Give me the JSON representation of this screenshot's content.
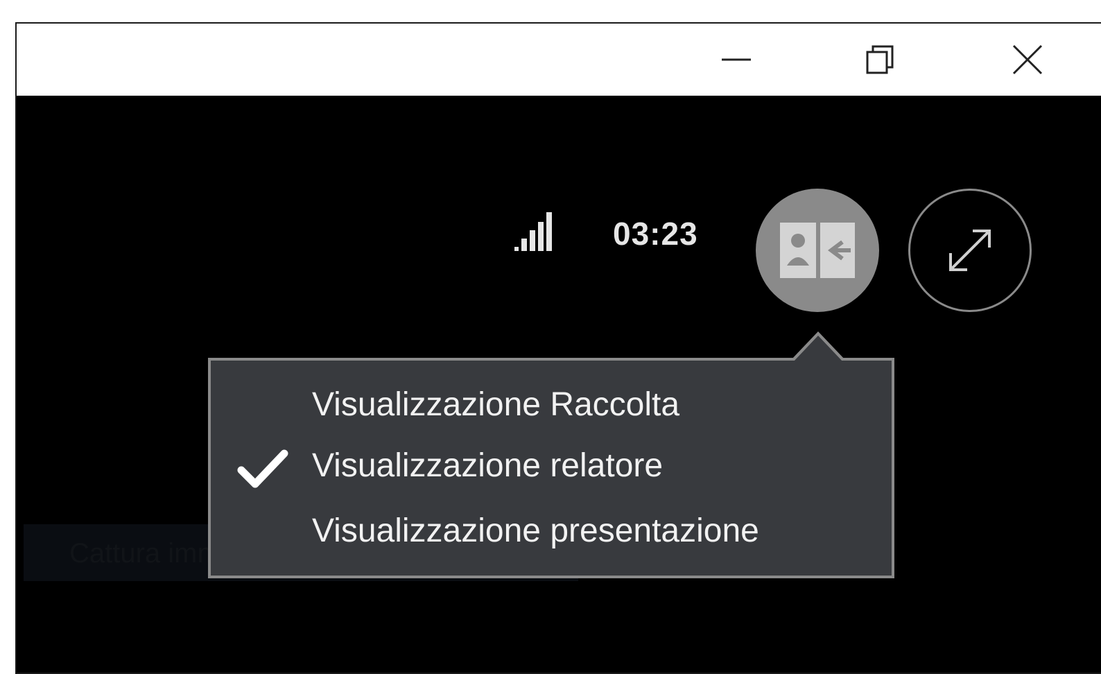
{
  "window": {
    "controls": {
      "minimize_icon": "minimize-icon",
      "maximize_icon": "restore-icon",
      "close_icon": "close-icon"
    }
  },
  "call": {
    "signal_icon": "signal-strength-icon",
    "timer": "03:23",
    "layout_button_icon": "presenter-layout-icon",
    "fullscreen_button_icon": "expand-icon"
  },
  "layout_menu": {
    "items": [
      {
        "label": "Visualizzazione Raccolta",
        "checked": false
      },
      {
        "label": "Visualizzazione relatore",
        "checked": true
      },
      {
        "label": "Visualizzazione presentazione",
        "checked": false
      }
    ]
  },
  "background_hint": {
    "text": "Cattura immagine"
  },
  "colors": {
    "content_bg": "#000000",
    "menu_bg": "#383a3e",
    "menu_border": "#8a8a8a",
    "menu_text": "#f2f2f2",
    "layout_button_bg": "#8a8a8a"
  }
}
